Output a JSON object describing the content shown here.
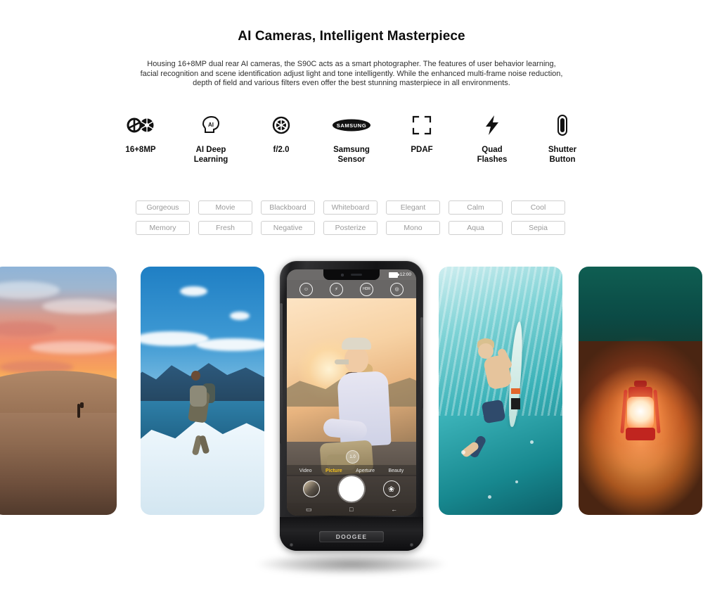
{
  "heading": {
    "title": "AI Cameras, Intelligent Masterpiece",
    "description": "Housing 16+8MP dual rear AI cameras, the S90C acts as a smart photographer. The features of user behavior learning, facial recognition and scene identification adjust light and tone intelligently. While the enhanced multi-frame noise reduction, depth of field and various filters even offer the best stunning masterpiece in all environments."
  },
  "features": [
    {
      "icon": "dual-aperture-icon",
      "label": "16+8MP"
    },
    {
      "icon": "ai-head-icon",
      "label": "AI Deep\nLearning"
    },
    {
      "icon": "aperture-icon",
      "label": "f/2.0"
    },
    {
      "icon": "samsung-logo-icon",
      "label": "Samsung\nSensor"
    },
    {
      "icon": "focus-frame-icon",
      "label": "PDAF"
    },
    {
      "icon": "lightning-bolt-icon",
      "label": "Quad\nFlashes"
    },
    {
      "icon": "shutter-button-icon",
      "label": "Shutter\nButton"
    }
  ],
  "filters": [
    "Gorgeous",
    "Movie",
    "Blackboard",
    "Whiteboard",
    "Elegant",
    "Calm",
    "Cool",
    "Memory",
    "Fresh",
    "Negative",
    "Posterize",
    "Mono",
    "Aqua",
    "Sepia"
  ],
  "gallery": [
    {
      "name": "desert-sunset-photo",
      "caption": "Desert sunset with lone hiker silhouette"
    },
    {
      "name": "mountain-hiker-photo",
      "caption": "Hiker running on snowy mountain ridge"
    },
    {
      "name": "underwater-surfer-photo",
      "caption": "Surfer diving underwater with surfboard"
    },
    {
      "name": "red-lantern-photo",
      "caption": "Glowing red lantern on night sand"
    }
  ],
  "phone": {
    "brand": "DOOGEE",
    "status_bar": {
      "time": "12:00",
      "battery": "battery-icon"
    },
    "camera_top_controls": [
      {
        "name": "portrait-mode-button",
        "glyph": "☺"
      },
      {
        "name": "flash-button",
        "glyph": "⚡"
      },
      {
        "name": "hdr-button",
        "glyph": "HDR"
      },
      {
        "name": "switch-camera-button",
        "glyph": "◎"
      }
    ],
    "zoom_level": "1.0",
    "modes": [
      {
        "label": "Video",
        "active": false
      },
      {
        "label": "Picture",
        "active": true
      },
      {
        "label": "Aperture",
        "active": false
      },
      {
        "label": "Beauty",
        "active": false
      }
    ],
    "controls": [
      {
        "name": "gallery-thumbnail-button"
      },
      {
        "name": "shutter-button"
      },
      {
        "name": "filter-button",
        "glyph": "❀"
      }
    ],
    "nav_bar": [
      {
        "name": "recents-button",
        "glyph": "▭"
      },
      {
        "name": "home-button",
        "glyph": "□"
      },
      {
        "name": "back-button",
        "glyph": "←"
      }
    ],
    "viewfinder_subject": "Smiling woman in cap and lavender jacket at golden hour"
  },
  "colors": {
    "title": "#0d0d0d",
    "body_text": "#2f2f2f",
    "chip_border": "#cfcfcf",
    "chip_text": "#9a9a9a",
    "mode_active": "#f4c01e",
    "background": "#ffffff"
  }
}
